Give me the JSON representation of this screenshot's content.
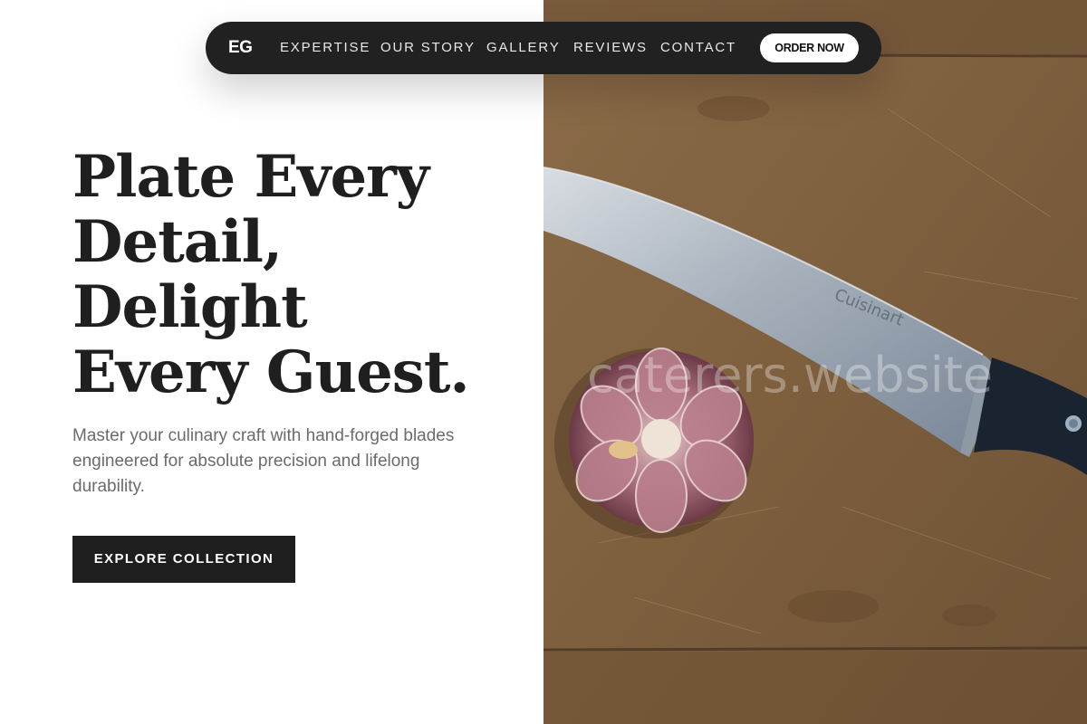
{
  "nav": {
    "logo": "EG",
    "links": [
      "EXPERTISE",
      "OUR STORY",
      "GALLERY",
      "REVIEWS",
      "CONTACT"
    ],
    "cta_label": "ORDER NOW"
  },
  "hero": {
    "title_lines": [
      "Plate Every",
      "Detail,",
      "Delight",
      "Every Guest."
    ],
    "subtitle": "Master your culinary craft with hand-forged blades engineered for absolute precision and lifelong durability.",
    "cta_label": "EXPLORE COLLECTION"
  },
  "photo": {
    "watermark": "caterers.website",
    "blade_text": "Cuisinart"
  },
  "colors": {
    "nav_bg": "#212121",
    "cta_bg": "#1e1e1e",
    "title": "#1f1f1f",
    "subtitle": "#6b6b6b",
    "wood": "#8a6a45"
  }
}
